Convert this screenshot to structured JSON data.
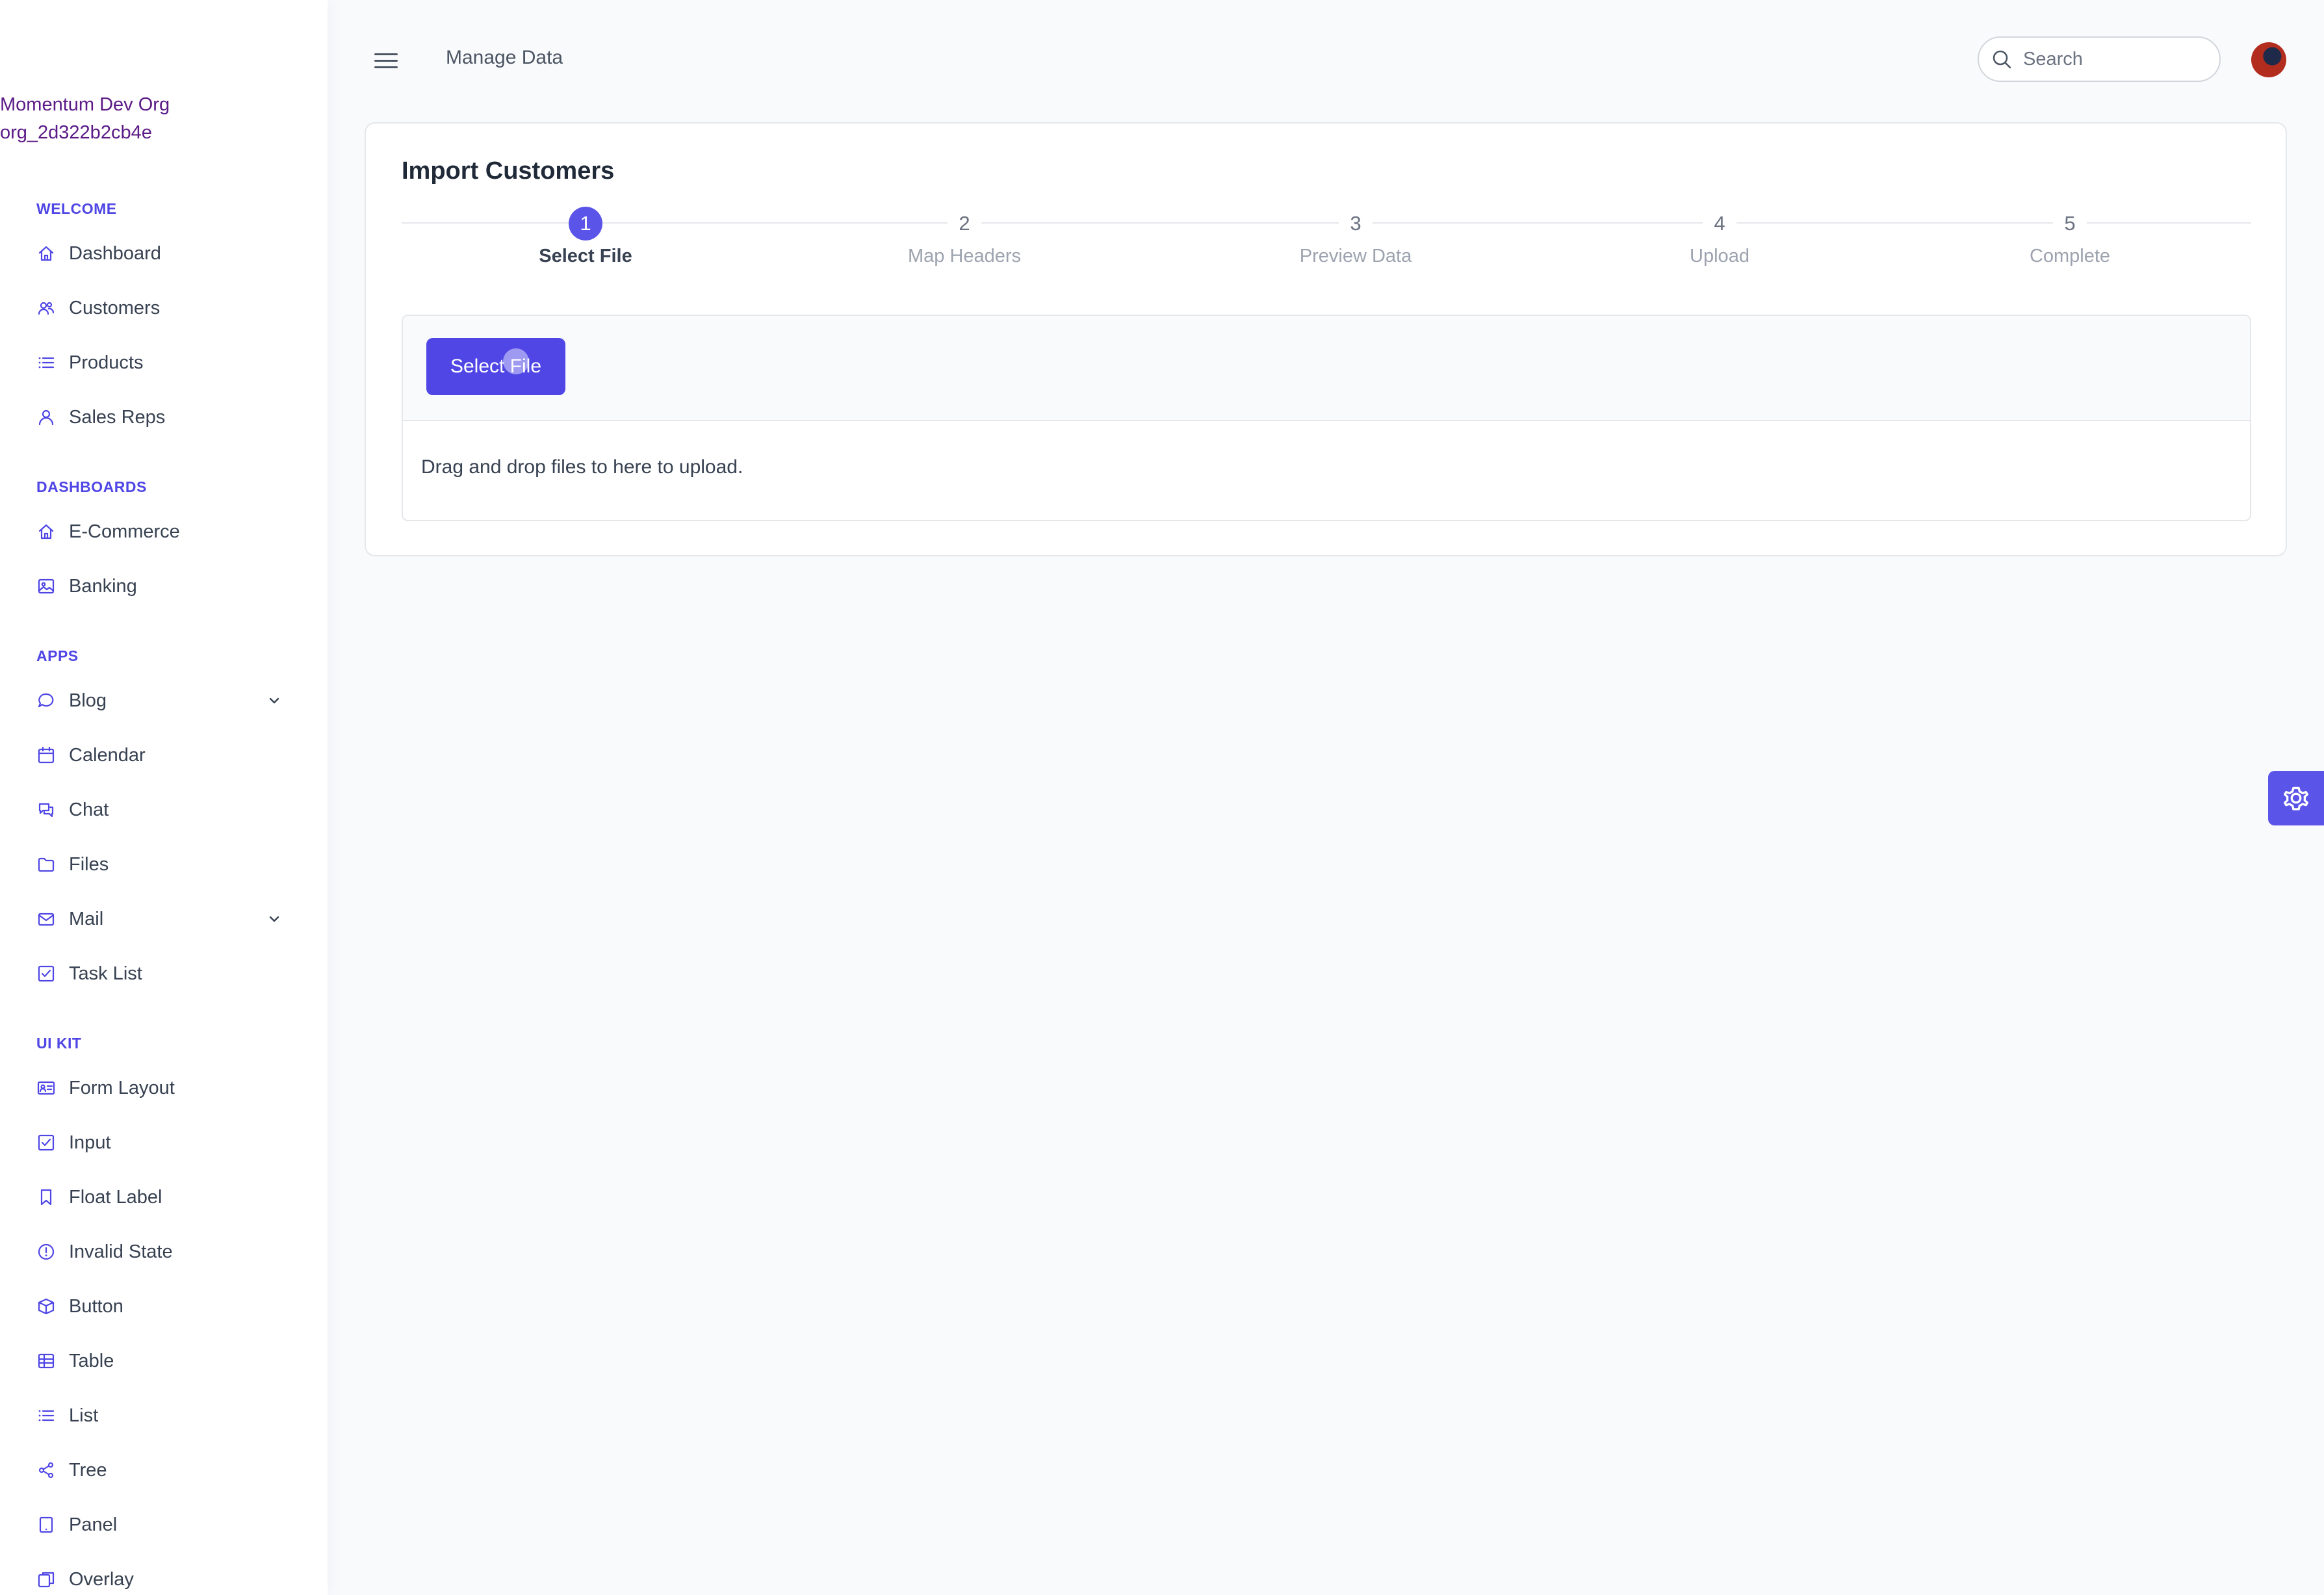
{
  "org": {
    "name": "Momentum Dev Org",
    "id": "org_2d322b2cb4e"
  },
  "sidebar": {
    "sections": [
      {
        "title": "WELCOME",
        "items": [
          {
            "label": "Dashboard",
            "icon": "home-icon"
          },
          {
            "label": "Customers",
            "icon": "users-icon"
          },
          {
            "label": "Products",
            "icon": "list-icon"
          },
          {
            "label": "Sales Reps",
            "icon": "user-icon"
          }
        ]
      },
      {
        "title": "DASHBOARDS",
        "items": [
          {
            "label": "E-Commerce",
            "icon": "home-icon"
          },
          {
            "label": "Banking",
            "icon": "image-icon"
          }
        ]
      },
      {
        "title": "APPS",
        "items": [
          {
            "label": "Blog",
            "icon": "comment-icon",
            "expandable": true
          },
          {
            "label": "Calendar",
            "icon": "calendar-icon"
          },
          {
            "label": "Chat",
            "icon": "chat-icon"
          },
          {
            "label": "Files",
            "icon": "folder-icon"
          },
          {
            "label": "Mail",
            "icon": "envelope-icon",
            "expandable": true
          },
          {
            "label": "Task List",
            "icon": "check-square-icon"
          }
        ]
      },
      {
        "title": "UI KIT",
        "items": [
          {
            "label": "Form Layout",
            "icon": "id-card-icon"
          },
          {
            "label": "Input",
            "icon": "check-square-icon"
          },
          {
            "label": "Float Label",
            "icon": "bookmark-icon"
          },
          {
            "label": "Invalid State",
            "icon": "exclamation-circle-icon"
          },
          {
            "label": "Button",
            "icon": "box-icon"
          },
          {
            "label": "Table",
            "icon": "table-icon"
          },
          {
            "label": "List",
            "icon": "list-icon"
          },
          {
            "label": "Tree",
            "icon": "share-icon"
          },
          {
            "label": "Panel",
            "icon": "tablet-icon"
          },
          {
            "label": "Overlay",
            "icon": "clone-icon"
          }
        ]
      }
    ]
  },
  "header": {
    "title": "Manage Data",
    "search_placeholder": "Search"
  },
  "card": {
    "title": "Import Customers",
    "steps": [
      {
        "number": "1",
        "label": "Select File",
        "active": true
      },
      {
        "number": "2",
        "label": "Map Headers",
        "active": false
      },
      {
        "number": "3",
        "label": "Preview Data",
        "active": false
      },
      {
        "number": "4",
        "label": "Upload",
        "active": false
      },
      {
        "number": "5",
        "label": "Complete",
        "active": false
      }
    ],
    "select_file_label": "Select File",
    "drop_text": "Drag and drop files to here to upload."
  },
  "colors": {
    "accent": "#4f46e5",
    "org_text": "#5b1a86"
  }
}
